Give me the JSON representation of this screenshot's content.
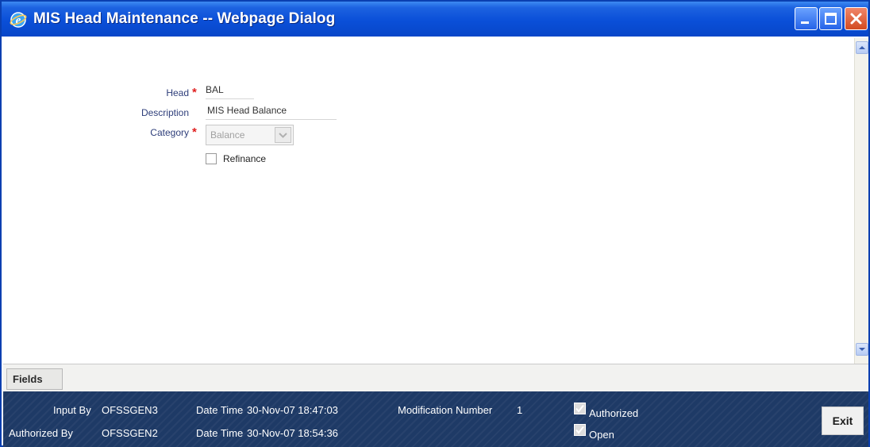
{
  "window": {
    "title": "MIS Head Maintenance -- Webpage Dialog"
  },
  "form": {
    "head_label": "Head",
    "head_value": "BAL",
    "description_label": "Description",
    "description_value": "MIS Head Balance",
    "category_label": "Category",
    "category_value": "Balance",
    "refinance_label": "Refinance",
    "refinance_checked": false,
    "required_mark": "*"
  },
  "tabs": {
    "fields_label": "Fields"
  },
  "footer": {
    "input_by_label": "Input By",
    "input_by_value": "OFSSGEN3",
    "authorized_by_label": "Authorized By",
    "authorized_by_value": "OFSSGEN2",
    "input_datetime_label": "Date Time",
    "input_datetime_value": "30-Nov-07 18:47:03",
    "auth_datetime_label": "Date Time",
    "auth_datetime_value": "30-Nov-07 18:54:36",
    "modification_label": "Modification Number",
    "modification_value": "1",
    "authorized_label": "Authorized",
    "authorized_checked": true,
    "open_label": "Open",
    "open_checked": true,
    "exit_label": "Exit"
  },
  "icons": {
    "title": "ie-icon",
    "minimize": "minimize-icon",
    "maximize": "maximize-icon",
    "close": "close-icon",
    "scroll_up": "arrow-up-icon",
    "scroll_down": "arrow-down-icon",
    "dropdown": "chevron-down-icon"
  },
  "colors": {
    "titlebar": "#0a4fd8",
    "footer": "#1e3a66",
    "required": "#e02020",
    "label": "#2e3e7a"
  }
}
